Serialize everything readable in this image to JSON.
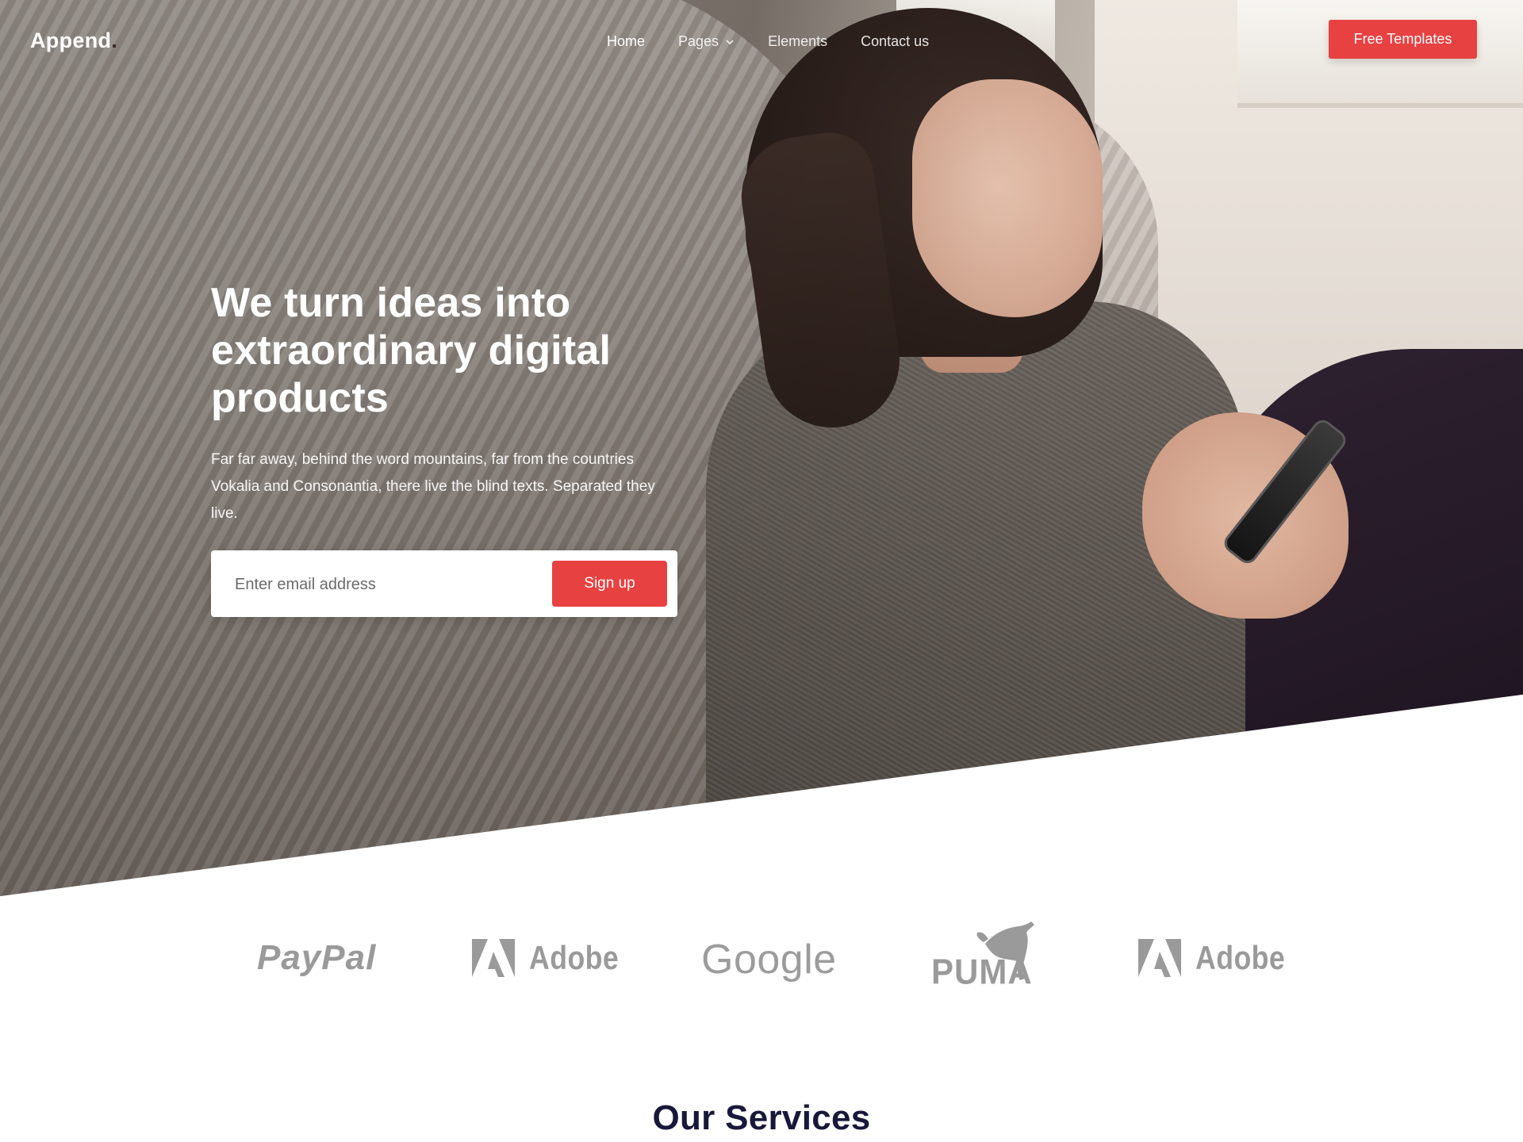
{
  "nav": {
    "logo_text": "Append",
    "logo_dot": ".",
    "menu": [
      {
        "label": "Home"
      },
      {
        "label": "Pages"
      },
      {
        "label": "Elements"
      },
      {
        "label": "Contact us"
      }
    ],
    "cta_label": "Free Templates"
  },
  "hero": {
    "title": "We turn ideas into extraordinary digital products",
    "subtitle": "Far far away, behind the word mountains, far from the countries Vokalia and Consonantia, there live the blind texts. Separated they live.",
    "email_placeholder": "Enter email address",
    "signup_label": "Sign up"
  },
  "brands": {
    "paypal": "PayPal",
    "adobe_1": "Adobe",
    "google": "Google",
    "puma": "PUMA",
    "adobe_2": "Adobe"
  },
  "services": {
    "title": "Our Services"
  },
  "colors": {
    "accent": "#e84141",
    "heading_dark": "#18183a",
    "brand_gray": "#9a9a9a"
  },
  "icons": [
    "chevron-down-icon",
    "adobe-logo-icon",
    "puma-cat-icon"
  ]
}
